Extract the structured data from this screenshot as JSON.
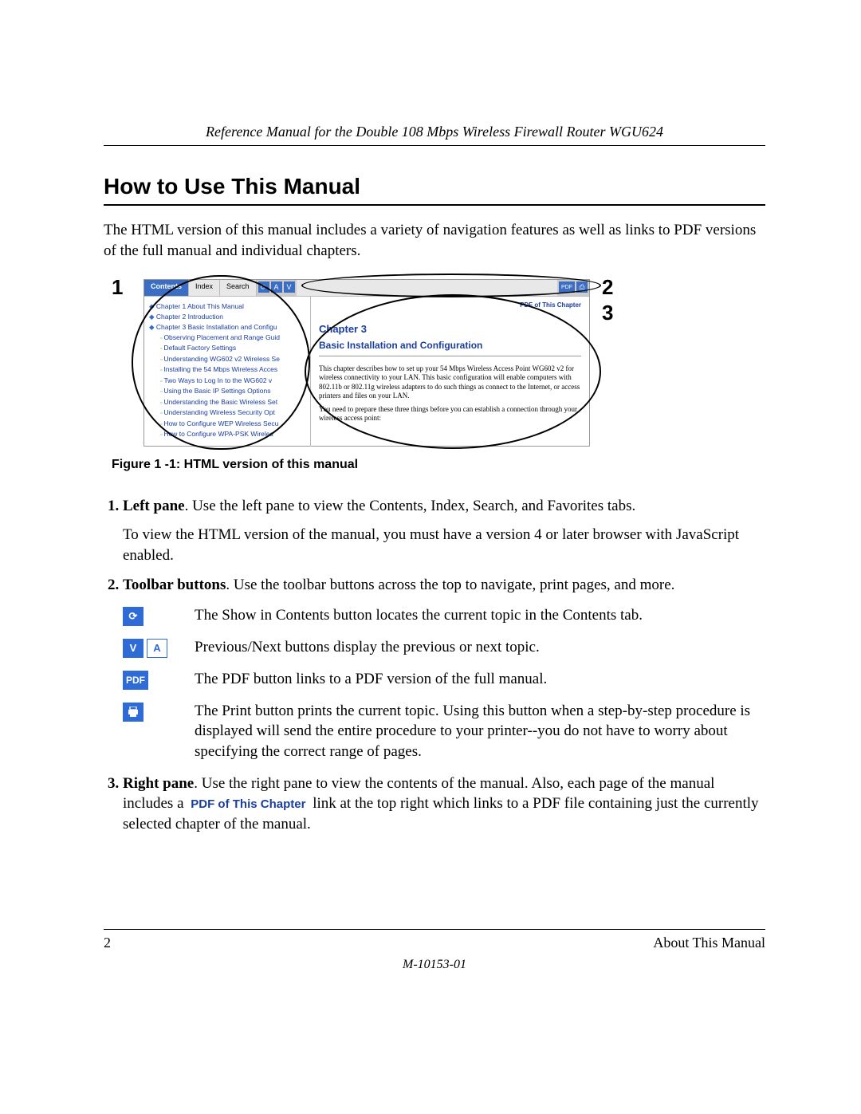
{
  "header": {
    "title": "Reference Manual for the Double 108 Mbps Wireless Firewall Router WGU624"
  },
  "heading": "How to Use This Manual",
  "intro": "The HTML version of this manual includes a variety of navigation features as well as links to PDF versions of the full manual and individual chapters.",
  "callouts": {
    "c1": "1",
    "c2": "2",
    "c3": "3"
  },
  "figure": {
    "tabs": {
      "contents": "Contents",
      "index": "Index",
      "search": "Search"
    },
    "toolbar_icons": {
      "refresh": "⟳",
      "up": "A",
      "down": "V",
      "pdf": "PDF",
      "print": "⎙"
    },
    "left_items": [
      {
        "lvl": 1,
        "text": "Chapter 1 About This Manual"
      },
      {
        "lvl": 1,
        "text": "Chapter 2 Introduction"
      },
      {
        "lvl": 1,
        "text": "Chapter 3 Basic Installation and Configu"
      },
      {
        "lvl": 2,
        "text": "Observing Placement and Range Guid"
      },
      {
        "lvl": 2,
        "text": "Default Factory Settings"
      },
      {
        "lvl": 2,
        "text": "Understanding WG602 v2 Wireless Se"
      },
      {
        "lvl": 2,
        "text": "Installing the 54 Mbps Wireless Acces"
      },
      {
        "lvl": 2,
        "text": "Two Ways to Log In to the WG602 v"
      },
      {
        "lvl": 2,
        "text": "Using the Basic IP Settings Options"
      },
      {
        "lvl": 2,
        "text": "Understanding the Basic Wireless Set"
      },
      {
        "lvl": 2,
        "text": "Understanding Wireless Security Opt"
      },
      {
        "lvl": 2,
        "text": "How to Configure WEP Wireless Secu"
      },
      {
        "lvl": 2,
        "text": "How to Configure WPA-PSK Wireles"
      }
    ],
    "right": {
      "pdf_link": "PDF of This Chapter",
      "chapter": "Chapter 3",
      "subtitle": "Basic Installation and Configuration",
      "p1": "This chapter describes how to set up your 54 Mbps Wireless Access Point WG602 v2 for wireless connectivity to your LAN. This basic configuration will enable computers with 802.11b or 802.11g wireless adapters to do such things as connect to the Internet, or access printers and files on your LAN.",
      "p2": "You need to prepare these three things before you can establish a connection through your wireless access point:"
    },
    "caption": "Figure 1 -1:  HTML version of this manual"
  },
  "list": {
    "item1": {
      "lead": "Left pane",
      "rest": ". Use the left pane to view the Contents, Index, Search, and Favorites tabs.",
      "sub": "To view the HTML version of the manual, you must have a version 4 or later browser with JavaScript enabled."
    },
    "item2": {
      "lead": "Toolbar buttons",
      "rest": ". Use the toolbar buttons across the top to navigate, print pages, and more.",
      "rows": {
        "refresh": "The Show in Contents button locates the current topic in the Contents tab.",
        "prevnext": "Previous/Next buttons display the previous or next topic.",
        "pdf": "The PDF button links to a PDF version of the full manual.",
        "print": "The Print button prints the current topic. Using this button when a step-by-step procedure is displayed will send the entire procedure to your printer--you do not have to worry about specifying the correct range of pages."
      }
    },
    "item3": {
      "lead": "Right pane",
      "rest_a": ". Use the right pane to view the contents of the manual. Also, each page of the manual includes a ",
      "link": "PDF of This Chapter",
      "rest_b": " link at the top right which links to a PDF file containing just the currently selected chapter of the manual."
    }
  },
  "footer": {
    "page": "2",
    "section": "About This Manual",
    "docnum": "M-10153-01"
  }
}
